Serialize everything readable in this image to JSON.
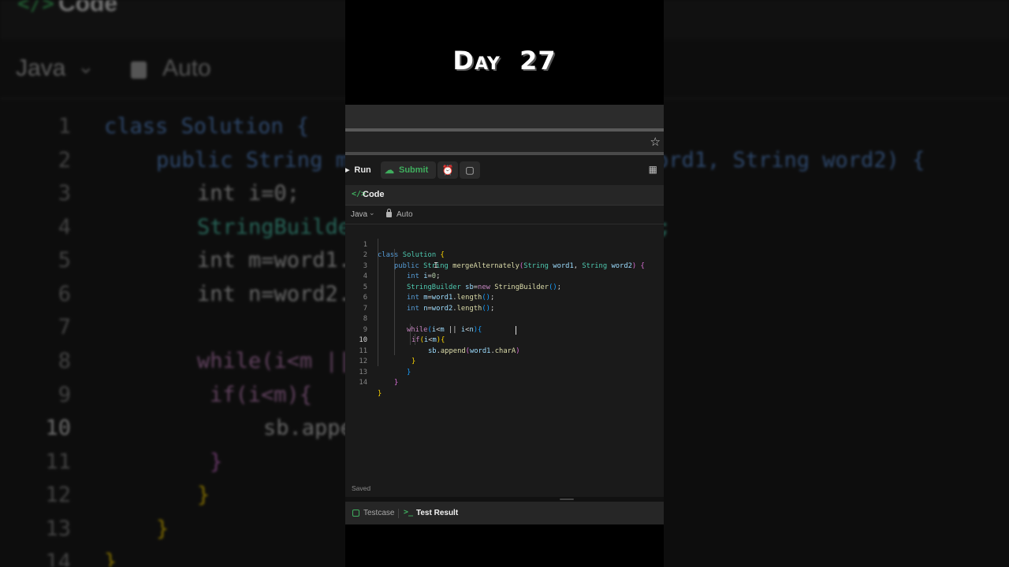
{
  "video_title": {
    "prefix": "Day",
    "number": "27"
  },
  "toolbar": {
    "run_label": "Run",
    "submit_label": "Submit"
  },
  "editor_header": {
    "code_icon": "</>",
    "tab_label": "Code",
    "language": "Java",
    "mode": "Auto"
  },
  "code": {
    "line_numbers": [
      "1",
      "2",
      "3",
      "4",
      "5",
      "6",
      "7",
      "8",
      "9",
      "10",
      "11",
      "12",
      "13",
      "14"
    ],
    "active_line": "10",
    "lines": [
      "class Solution {",
      "public String mergeAlternately(String word1, String word2) {",
      "int i=0;",
      "StringBuilder sb=new StringBuilder();",
      "int m=word1.length();",
      "int n=word2.length();",
      "",
      "while(i<m || i<n){",
      "if(i<m){",
      "sb.append(word1.charA)",
      "}",
      "}",
      "}",
      "}"
    ]
  },
  "status": {
    "saved": "Saved"
  },
  "bottom_tabs": {
    "testcase": "Testcase",
    "test_result": "Test Result"
  },
  "icons": {
    "star": "star-icon",
    "alarm": "alarm-clock-icon",
    "note": "note-icon",
    "layout": "layout-grid-icon",
    "lock": "lock-icon",
    "cloud": "cloud-upload-icon"
  },
  "colors": {
    "accent_green": "#3fae5e",
    "keyword_blue": "#569cd6",
    "type_teal": "#4ec9b0",
    "function_yellow": "#dcdcaa",
    "control_purple": "#c586c0"
  }
}
